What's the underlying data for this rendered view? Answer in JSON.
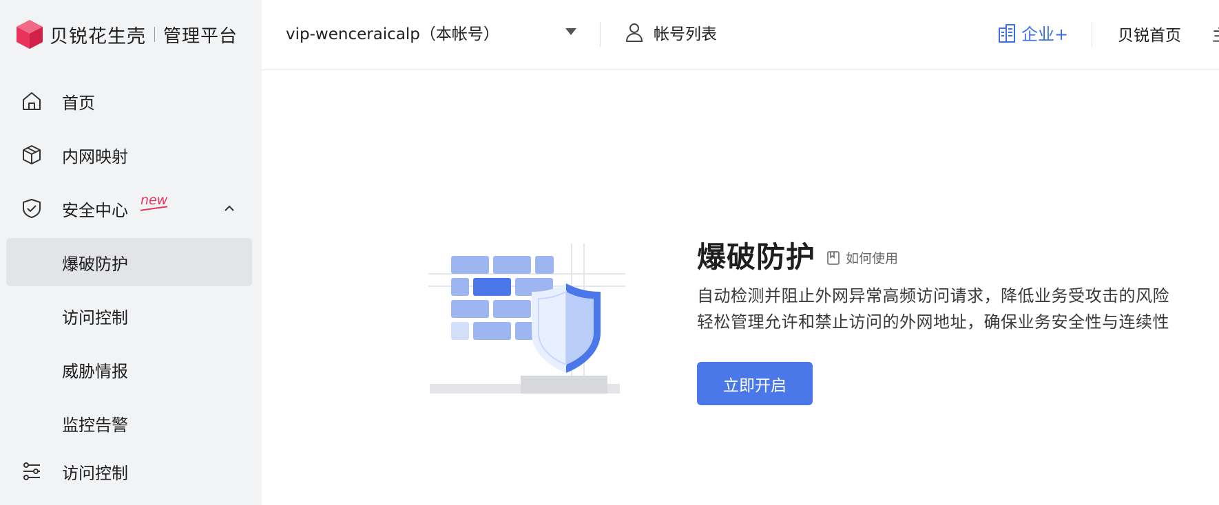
{
  "brand": {
    "name": "贝锐花生壳",
    "subtitle": "管理平台",
    "brand_color": "#e8335b"
  },
  "sidebar": {
    "items": [
      {
        "label": "首页",
        "icon": "home-icon"
      },
      {
        "label": "内网映射",
        "icon": "cube-icon"
      },
      {
        "label": "安全中心",
        "icon": "shield-check-icon",
        "badge": "new",
        "expanded": true,
        "children": [
          {
            "label": "爆破防护",
            "active": true
          },
          {
            "label": "访问控制"
          },
          {
            "label": "威胁情报"
          },
          {
            "label": "监控告警"
          }
        ]
      },
      {
        "label": "访问控制",
        "icon": "sliders-icon"
      }
    ]
  },
  "header": {
    "account": "vip-wenceraicalp（本帐号）",
    "account_list": "帐号列表",
    "enterprise": "企业+",
    "home": "贝锐首页",
    "more": "主"
  },
  "main": {
    "title": "爆破防护",
    "howto": "如何使用",
    "desc_line1": "自动检测并阻止外网异常高频访问请求，降低业务受攻击的风险",
    "desc_line2": "轻松管理允许和禁止访问的外网地址，确保业务安全性与连续性",
    "cta": "立即开启",
    "accent_color": "#4a78e8"
  }
}
